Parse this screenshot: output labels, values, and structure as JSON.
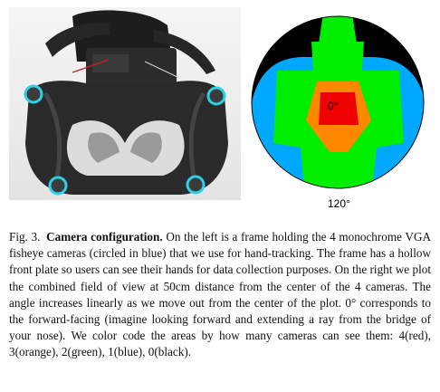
{
  "figure": {
    "fov_plot": {
      "center_label": "0°",
      "edge_label": "120°",
      "colors": {
        "4_cameras": "#ee0000",
        "3_cameras": "#ff8800",
        "2_cameras": "#00ee00",
        "1_camera": "#00a8ff",
        "0_cameras": "#000000"
      }
    },
    "photo": {
      "marker_color": "#2fd0e6"
    }
  },
  "caption": {
    "number": "Fig. 3.",
    "title": "Camera configuration.",
    "body": "On the left is a frame holding the 4 monochrome VGA fisheye cameras (circled in blue) that we use for hand-tracking. The frame has a hollow front plate so users can see their hands for data collection purposes. On the right we plot the combined field of view at 50cm distance from the center of the 4 cameras. The angle increases linearly as we move out from the center of the plot. 0° corresponds to the forward-facing (imagine looking forward and extending a ray from the bridge of your nose). We color code the areas by how many cameras can see them: 4(red), 3(orange), 2(green), 1(blue), 0(black)."
  }
}
